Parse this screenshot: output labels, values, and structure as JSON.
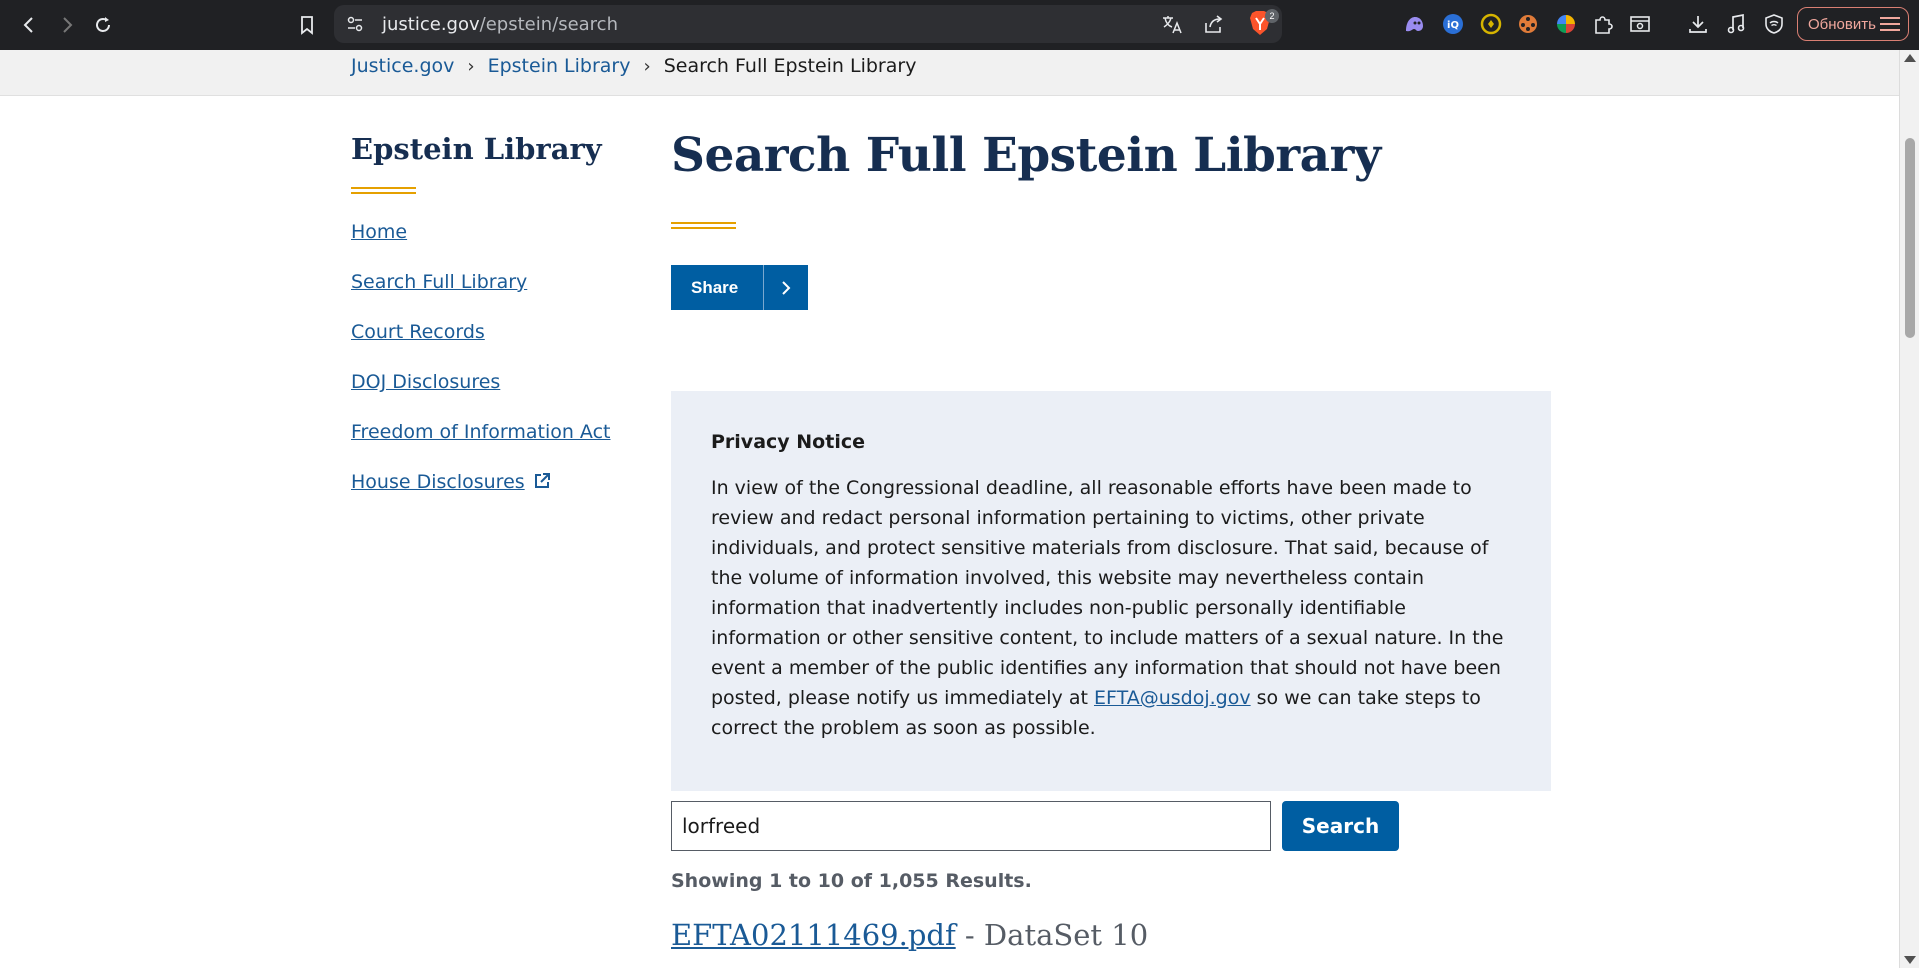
{
  "browser": {
    "url_host": "justice.gov",
    "url_path": "/epstein/search",
    "shield_count": "2",
    "update_label": "Обновить"
  },
  "breadcrumb": {
    "items": [
      "Justice.gov",
      "Epstein Library"
    ],
    "separator": "›",
    "current": "Search Full Epstein Library"
  },
  "sidebar": {
    "title": "Epstein Library",
    "items": [
      {
        "label": "Home"
      },
      {
        "label": "Search Full Library"
      },
      {
        "label": "Court Records"
      },
      {
        "label": "DOJ Disclosures"
      },
      {
        "label": "Freedom of Information Act"
      },
      {
        "label": "House Disclosures"
      }
    ]
  },
  "main": {
    "title": "Search Full Epstein Library",
    "share_label": "Share",
    "notice": {
      "title": "Privacy Notice",
      "body_before": "In view of the Congressional deadline, all reasonable efforts have been made to review and redact personal information pertaining to victims, other private individuals, and protect sensitive materials from disclosure.  That said, because of the volume of information involved, this website may nevertheless contain information that inadvertently includes non-public personally identifiable information or other sensitive content, to include matters of a sexual nature.  In the event a member of the public identifies any information that should not have been posted, please notify us immediately at ",
      "email": "EFTA@usdoj.gov",
      "body_after": " so we can take steps to correct the problem as soon as possible."
    },
    "search": {
      "value": "lorfreed",
      "button_label": "Search"
    },
    "results_count": "Showing 1 to 10 of 1,055 Results.",
    "results": [
      {
        "file": "EFTA02111469.pdf",
        "dataset": " - DataSet 10"
      }
    ]
  },
  "colors": {
    "link": "#1a5a96",
    "primary_button": "#005ea2",
    "heading": "#162e51",
    "accent_rule": "#e5a000",
    "notice_bg": "#ebeff6"
  }
}
